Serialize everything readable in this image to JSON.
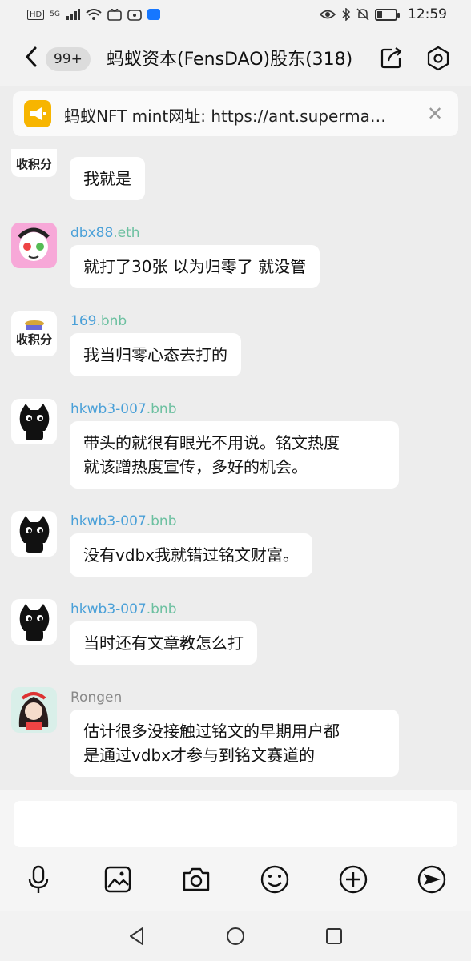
{
  "status_bar": {
    "left_label": "HD",
    "network": "5G",
    "time": "12:59"
  },
  "header": {
    "unread_badge": "99+",
    "title": "蚂蚁资本(FensDAO)股东(318)"
  },
  "notice": {
    "text": "蚂蚁NFT mint网址: https://ant.superma…"
  },
  "messages": [
    {
      "avatar_text": "收积分",
      "sender": "",
      "text": "我就是"
    },
    {
      "sender_main": "dbx88",
      "sender_suffix": ".eth",
      "text": "就打了30张 以为归零了 就没管"
    },
    {
      "avatar_text": "收积分",
      "sender_main": "169",
      "sender_suffix": ".bnb",
      "text": "我当归零心态去打的"
    },
    {
      "sender_main": "hkwb3-007",
      "sender_suffix": ".bnb",
      "text_line1": "带头的就很有眼光不用说。铭文热度",
      "text_line2": "就该蹭热度宣传，多好的机会。"
    },
    {
      "sender_main": "hkwb3-007",
      "sender_suffix": ".bnb",
      "text": "没有vdbx我就错过铭文财富。"
    },
    {
      "sender_main": "hkwb3-007",
      "sender_suffix": ".bnb",
      "text": "当时还有文章教怎么打"
    },
    {
      "sender": "Rongen",
      "text_line1": "估计很多没接触过铭文的早期用户都",
      "text_line2": "是通过vdbx才参与到铭文赛道的"
    }
  ],
  "toolbar": [
    "mic-icon",
    "image-icon",
    "camera-icon",
    "emoji-icon",
    "plus-icon",
    "send-icon"
  ],
  "colors": {
    "accent_blue": "#4aa0d8",
    "accent_green": "#6cc0a0",
    "notice_yellow": "#f7b500"
  }
}
